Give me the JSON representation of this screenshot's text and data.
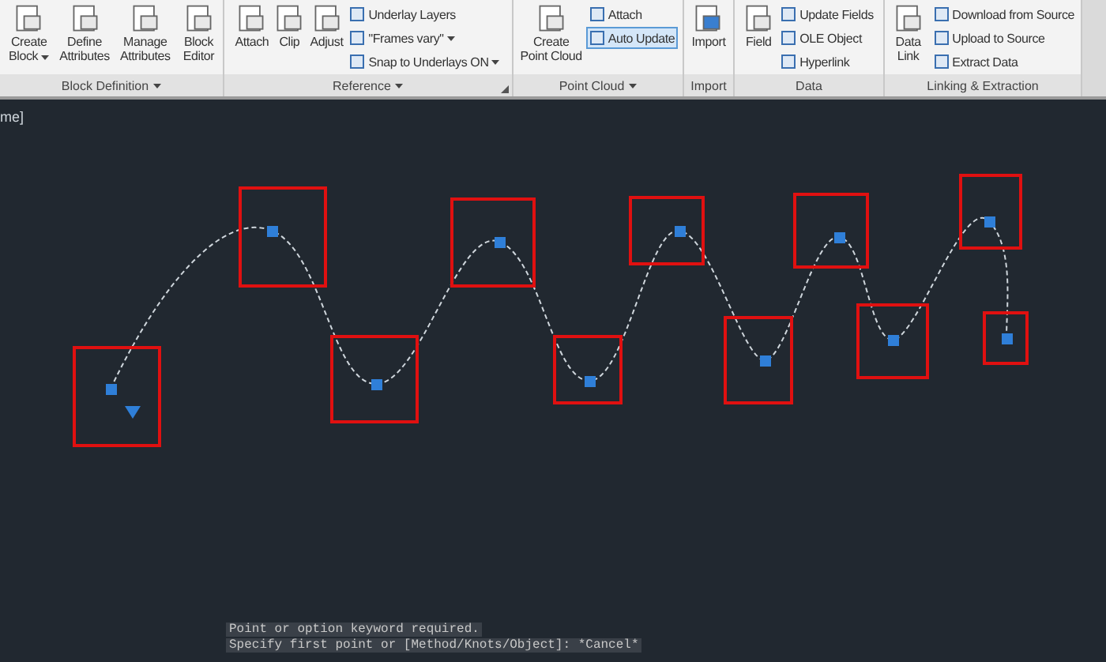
{
  "ribbon": {
    "panels": [
      {
        "title": "Block Definition",
        "dropdown": true,
        "large": [
          {
            "label": "Create Block",
            "dropdown": true
          },
          {
            "label": "Define Attributes",
            "dropdown": false
          },
          {
            "label": "Manage Attributes",
            "dropdown": false
          },
          {
            "label": "Block Editor",
            "dropdown": false
          }
        ]
      },
      {
        "title": "Reference",
        "dropdown": true,
        "launcher": true,
        "large": [
          {
            "label": "Attach",
            "dropdown": false
          },
          {
            "label": "Clip",
            "dropdown": false
          },
          {
            "label": "Adjust",
            "dropdown": false
          }
        ],
        "small": [
          {
            "label": "Underlay Layers",
            "on": false,
            "dropdown": false
          },
          {
            "label": "\"Frames vary\"",
            "on": false,
            "dropdown": true
          },
          {
            "label": "Snap to Underlays ON",
            "on": false,
            "dropdown": true
          }
        ]
      },
      {
        "title": "Point Cloud",
        "dropdown": true,
        "large": [
          {
            "label": "Create Point Cloud",
            "dropdown": false
          }
        ],
        "small": [
          {
            "label": "Attach",
            "on": false,
            "dropdown": false
          },
          {
            "label": "Auto Update",
            "on": true,
            "dropdown": false
          }
        ]
      },
      {
        "title": "Import",
        "dropdown": false,
        "large": [
          {
            "label": "Import",
            "dropdown": false
          }
        ]
      },
      {
        "title": "Data",
        "dropdown": false,
        "large": [
          {
            "label": "Field",
            "dropdown": false
          }
        ],
        "small": [
          {
            "label": "Update Fields",
            "on": false,
            "dropdown": false
          },
          {
            "label": "OLE Object",
            "on": false,
            "dropdown": false
          },
          {
            "label": "Hyperlink",
            "on": false,
            "dropdown": false
          }
        ]
      },
      {
        "title": "Linking & Extraction",
        "dropdown": false,
        "large": [
          {
            "label": "Data Link",
            "dropdown": false
          }
        ],
        "small": [
          {
            "label": "Download from Source",
            "on": false,
            "dropdown": false
          },
          {
            "label": "Upload to Source",
            "on": false,
            "dropdown": false
          },
          {
            "label": "Extract Data",
            "on": false,
            "dropdown": false
          }
        ]
      }
    ]
  },
  "viewport_label": "me]",
  "command_history": [
    "Point or option keyword required.",
    "Specify first point or [Method/Knots/Object]: *Cancel*"
  ]
}
